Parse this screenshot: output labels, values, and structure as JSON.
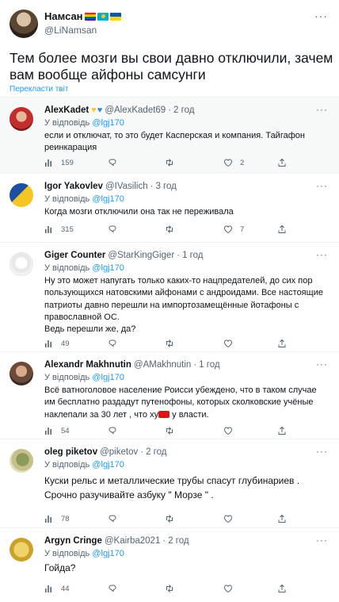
{
  "main_tweet": {
    "author_name": "Намсан",
    "author_handle": "@LiNamsan",
    "text": "Тем более мозги вы свои давно отключили, зачем вам вообще айфоны самсунги",
    "translate_label": "Перекласти твіт",
    "more_icon": "more-dots-icon"
  },
  "replying_to_label": "У відповідь",
  "replies": [
    {
      "name": "AlexKadet",
      "has_hearts": true,
      "handle": "@AlexKadet69",
      "time": "2 год",
      "replying_to": "@lgj170",
      "text": [
        "если и отключат, то это будет Касперская и компания. Тайгафон реинкарация"
      ],
      "views": "159",
      "replies_count": "",
      "retweets": "",
      "likes": "2"
    },
    {
      "name": "Igor Yakovlev",
      "has_hearts": false,
      "handle": "@IVasilich",
      "time": "3 год",
      "replying_to": "@lgj170",
      "text": [
        "Когда мозги отключили она так не переживала"
      ],
      "views": "315",
      "replies_count": "",
      "retweets": "",
      "likes": "7"
    },
    {
      "name": "Giger Counter",
      "has_hearts": false,
      "handle": "@StarKingGiger",
      "time": "1 год",
      "replying_to": "@lgj170",
      "text": [
        "Ну это может напугать только каких-то нацпредателей, до сих пор пользующихся натовскими айфонами с андроидами. Все настоящие патриоты давно перешли на импортозамещённые йотафоны с православной ОС.",
        "Ведь перешли же, да?"
      ],
      "views": "49",
      "replies_count": "",
      "retweets": "",
      "likes": ""
    },
    {
      "name": "Alexandr Makhnutin",
      "has_hearts": false,
      "handle": "@AMakhnutin",
      "time": "1 год",
      "replying_to": "@lgj170",
      "text": [
        "Всё ватноголовое население Роисси убеждено, что в таком случае им бесплатно раздадут путенофоны, которых сколковские учёные наклепали за 30 лет , что ху",
        "у власти."
      ],
      "views": "54",
      "replies_count": "",
      "retweets": "",
      "likes": ""
    },
    {
      "name": "oleg piketov",
      "has_hearts": false,
      "handle": "@piketov",
      "time": "2 год",
      "replying_to": "@lgj170",
      "text": [
        "Куски рельс и металлические трубы спасут глубинариев . Срочно разучивайте азбуку \" Морзе \" ."
      ],
      "views": "78",
      "replies_count": "",
      "retweets": "",
      "likes": ""
    },
    {
      "name": "Argyn Cringe",
      "has_hearts": false,
      "handle": "@Kairba2021",
      "time": "2 год",
      "replying_to": "@lgj170",
      "text": [
        "Гойда?"
      ],
      "views": "44",
      "replies_count": "",
      "retweets": "",
      "likes": ""
    }
  ],
  "colors": {
    "link": "#1d9bf0",
    "muted": "#536471",
    "highlight_bg": "#f7f9f9",
    "redaction": "#d81919"
  },
  "icons": [
    "reply-icon",
    "retweet-icon",
    "like-icon",
    "share-icon",
    "views-icon",
    "more-dots-icon"
  ]
}
